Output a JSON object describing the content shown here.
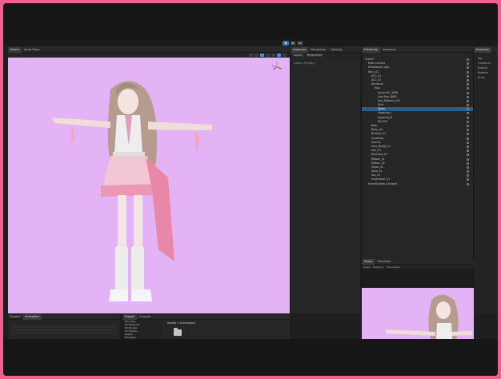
{
  "window": {
    "border_color": "#f0608e"
  },
  "toolbar": {
    "play_icons": [
      "play-icon",
      "pause-icon",
      "step-icon"
    ]
  },
  "scene_panel": {
    "tabs": [
      "Scene",
      "Asset Store"
    ],
    "bg_color": "#e3b3f5"
  },
  "inspector_panel": {
    "tabs": [
      "Inspector",
      "Navigation",
      "Lighting"
    ],
    "sub_tabs": [
      "Layers",
      "Preferences"
    ],
    "empty_text": "Layers (Empty)"
  },
  "hierarchy_panel": {
    "tabs": [
      "Hierarchy",
      "Inspector"
    ],
    "rows": [
      {
        "label": "Scene*",
        "indent": 0,
        "selected": false
      },
      {
        "label": "Main Camera",
        "indent": 1,
        "selected": false
      },
      {
        "label": "Directional Light",
        "indent": 1,
        "selected": false
      },
      {
        "label": "Haru_01",
        "indent": 1,
        "selected": false
      },
      {
        "label": "ACC_01",
        "indent": 2,
        "selected": false
      },
      {
        "label": "ACC_02",
        "indent": 2,
        "selected": false
      },
      {
        "label": "Armature",
        "indent": 2,
        "selected": false
      },
      {
        "label": "Hips",
        "indent": 3,
        "selected": false
      },
      {
        "label": "Spine.001_SKIN",
        "indent": 4,
        "selected": false
      },
      {
        "label": "Upp.Skin_BIND",
        "indent": 4,
        "selected": false
      },
      {
        "label": "Upp_Ribbons_001",
        "indent": 4,
        "selected": false
      },
      {
        "label": "Skirt",
        "indent": 4,
        "selected": false
      },
      {
        "label": "Spine",
        "indent": 4,
        "selected": true
      },
      {
        "label": "Upperleg_L",
        "indent": 4,
        "selected": false
      },
      {
        "label": "Upperleg_R",
        "indent": 4,
        "selected": false
      },
      {
        "label": "Tail.002",
        "indent": 4,
        "selected": false
      },
      {
        "label": "Body",
        "indent": 2,
        "selected": false
      },
      {
        "label": "Body_w0",
        "indent": 2,
        "selected": false
      },
      {
        "label": "Brushes_01",
        "indent": 2,
        "selected": false
      },
      {
        "label": "Eyebrows",
        "indent": 2,
        "selected": false
      },
      {
        "label": "Earring",
        "indent": 2,
        "selected": false
      },
      {
        "label": "Face_Bangs_01",
        "indent": 2,
        "selected": false
      },
      {
        "label": "Hair_01",
        "indent": 2,
        "selected": false
      },
      {
        "label": "Necklace_01",
        "indent": 2,
        "selected": false
      },
      {
        "label": "Ribbon_01",
        "indent": 2,
        "selected": false
      },
      {
        "label": "Ribbon_02",
        "indent": 2,
        "selected": false
      },
      {
        "label": "Shoes_01",
        "indent": 2,
        "selected": false
      },
      {
        "label": "Shoe_01",
        "indent": 2,
        "selected": false
      },
      {
        "label": "Top_01",
        "indent": 2,
        "selected": false
      },
      {
        "label": "Underwear_01",
        "indent": 2,
        "selected": false
      },
      {
        "label": "EventSystem (Unused)",
        "indent": 1,
        "selected": false
      }
    ]
  },
  "right_strip": {
    "tabs": [
      "Inspector"
    ],
    "labels": [
      "Tag",
      "Transform",
      "Position",
      "Rotation",
      "Scale"
    ]
  },
  "game_panel": {
    "tabs": [
      "Game",
      "Simulator"
    ],
    "bar_items": [
      "Game",
      "Display 1",
      "Free Aspect"
    ],
    "bg_color": "#e3b3f5"
  },
  "animation_panel": {
    "tabs": [
      "Project",
      "Animation"
    ]
  },
  "project_panel": {
    "tabs": [
      "Project",
      "Console"
    ],
    "sidebar": [
      "Favorites",
      "All Materials",
      "All Models",
      "All Prefabs",
      "Assets",
      "Packages"
    ],
    "breadcrumb": "Assets > Animations"
  }
}
